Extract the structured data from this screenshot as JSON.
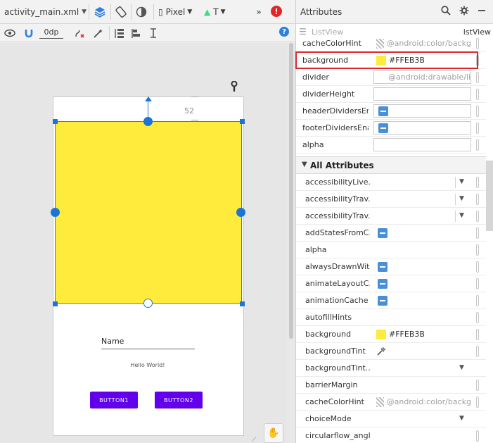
{
  "toolbar": {
    "file_tab": "activity_main.xml",
    "device": "Pixel",
    "api": "T",
    "default_margin": "0dp",
    "overflow": "»",
    "error_badge": "!",
    "help": "?"
  },
  "icons": {
    "layers": "layers-icon",
    "orientation": "rotate-icon",
    "theme": "theme-icon",
    "device": "phone-icon",
    "android": "android-icon",
    "view": "eye-icon",
    "magnet": "magnet-icon",
    "clear": "clear-constraints-icon",
    "infer": "magic-wand-icon",
    "pack": "pack-icon",
    "align": "align-icon",
    "guides": "guidelines-icon"
  },
  "design": {
    "margin_label": "52",
    "listview_color": "#FFEB3B",
    "name_field": "Name",
    "hello_text": "Hello World!",
    "button1": "BUTTON1",
    "button2": "BUTTON2",
    "button_color": "#6200EE",
    "selection_color": "#1E74D6"
  },
  "attributes": {
    "title": "Attributes",
    "component_type": "ListView",
    "component_name": "lstView",
    "common_rows": [
      {
        "label": "cacheColorHint",
        "value": "@android:color/backg"
      },
      {
        "label": "background",
        "value": "#FFEB3B"
      },
      {
        "label": "divider",
        "value": "@android:drawable/lis"
      },
      {
        "label": "dividerHeight",
        "value": ""
      },
      {
        "label": "headerDividersEn...",
        "value": ""
      },
      {
        "label": "footerDividersEna...",
        "value": ""
      },
      {
        "label": "alpha",
        "value": ""
      }
    ],
    "all_section": "All Attributes",
    "all_rows": [
      {
        "label": "accessibilityLive..."
      },
      {
        "label": "accessibilityTrav..."
      },
      {
        "label": "accessibilityTrav..."
      },
      {
        "label": "addStatesFromC..."
      },
      {
        "label": "alpha"
      },
      {
        "label": "alwaysDrawnWit..."
      },
      {
        "label": "animateLayoutC..."
      },
      {
        "label": "animationCache"
      },
      {
        "label": "autofillHints"
      },
      {
        "label": "background",
        "value": "#FFEB3B"
      },
      {
        "label": "backgroundTint"
      },
      {
        "label": "backgroundTint..."
      },
      {
        "label": "barrierMargin"
      },
      {
        "label": "cacheColorHint",
        "value": "@android:color/backg"
      },
      {
        "label": "choiceMode"
      },
      {
        "label": "circularflow_angl..."
      }
    ],
    "highlight_color": "#E0262B"
  }
}
